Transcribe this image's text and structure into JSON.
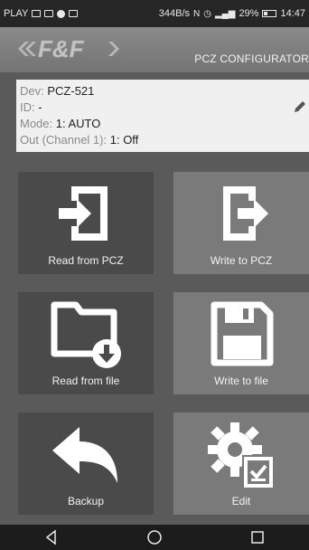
{
  "status_bar": {
    "carrier": "PLAY",
    "speed": "344B/s",
    "battery": "29%",
    "time": "14:47"
  },
  "app_bar": {
    "logo_text": "F&F",
    "title": "PCZ CONFIGURATOR"
  },
  "device_info": {
    "dev_label": "Dev:",
    "dev_value": "PCZ-521",
    "id_label": "ID:",
    "id_value": "-",
    "mode_label": "Mode:",
    "mode_value": "1: AUTO",
    "out_label": "Out (Channel 1):",
    "out_value": "1: Off"
  },
  "tiles": [
    {
      "label": "Read from PCZ",
      "icon": "import-icon"
    },
    {
      "label": "Write to PCZ",
      "icon": "export-icon"
    },
    {
      "label": "Read from file",
      "icon": "folder-download-icon"
    },
    {
      "label": "Write to file",
      "icon": "floppy-disk-icon"
    },
    {
      "label": "Backup",
      "icon": "backup-arrow-icon"
    },
    {
      "label": "Edit",
      "icon": "settings-edit-icon"
    }
  ],
  "nav": [
    "back-icon",
    "home-icon",
    "recents-icon"
  ]
}
